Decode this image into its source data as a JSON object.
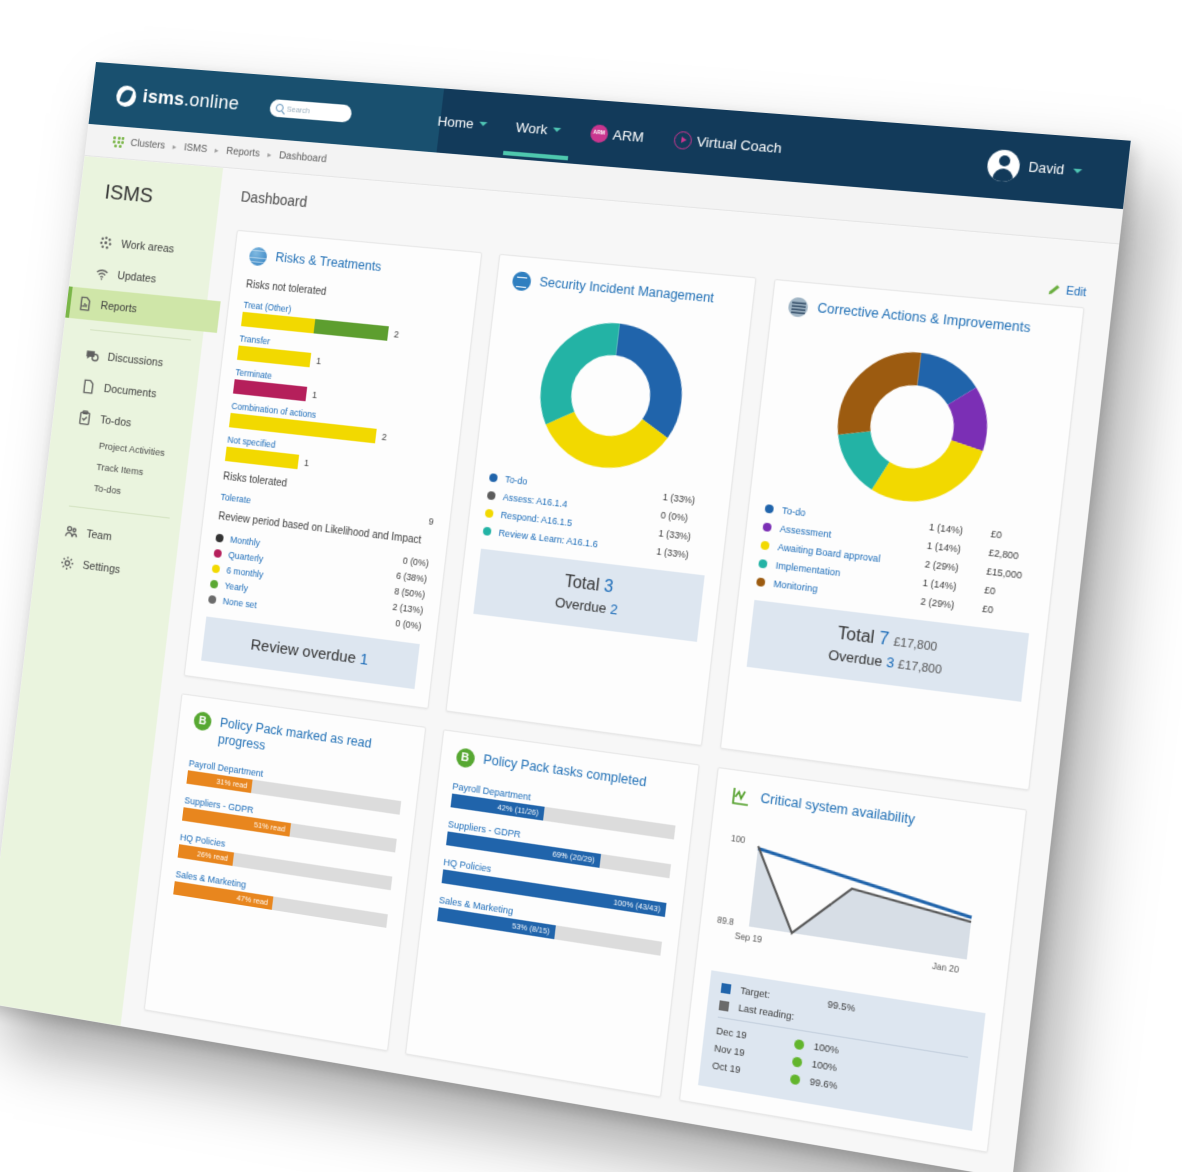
{
  "topnav": {
    "brand_bold": "isms",
    "brand_rest": ".online",
    "search_placeholder": "Search",
    "items": [
      {
        "label": "Home",
        "icon": "chevron-down-icon",
        "active": false
      },
      {
        "label": "Work",
        "icon": "chevron-down-icon",
        "active": true
      },
      {
        "label": "ARM",
        "icon": "arm-badge-icon",
        "active": false
      },
      {
        "label": "Virtual Coach",
        "icon": "play-circle-icon",
        "active": false
      }
    ],
    "arm_badge_text": "ARM",
    "user_name": "David"
  },
  "breadcrumb": {
    "icon": "clusters-grid-icon",
    "items": [
      "Clusters",
      "ISMS",
      "Reports",
      "Dashboard"
    ],
    "separator": "▸"
  },
  "sidebar": {
    "title": "ISMS",
    "group1": [
      {
        "label": "Work areas",
        "icon": "work-areas-icon",
        "active": false
      },
      {
        "label": "Updates",
        "icon": "updates-wifi-icon",
        "active": false
      },
      {
        "label": "Reports",
        "icon": "reports-document-icon",
        "active": true
      }
    ],
    "group2": [
      {
        "label": "Discussions",
        "icon": "discussions-icon",
        "active": false
      },
      {
        "label": "Documents",
        "icon": "documents-icon",
        "active": false
      },
      {
        "label": "To-dos",
        "icon": "todos-clipboard-icon",
        "active": false
      }
    ],
    "subitems": [
      "Project Activities",
      "Track Items",
      "To-dos"
    ],
    "group3": [
      {
        "label": "Team",
        "icon": "team-icon",
        "active": false
      },
      {
        "label": "Settings",
        "icon": "settings-gear-icon",
        "active": false
      }
    ]
  },
  "page": {
    "title": "Dashboard",
    "edit_label": "Edit",
    "edit_icon": "pencil-icon"
  },
  "colors": {
    "brand_navy": "#123a5a",
    "accent_teal": "#4ec8ae",
    "link_blue": "#1a6bb8",
    "green": "#7ab648",
    "yellow": "#f2d900",
    "magenta": "#b51f5b",
    "orange": "#e8861e",
    "blue": "#2064ab",
    "purple": "#7b2fb5",
    "teal": "#23b3a5",
    "brown": "#9c5b10"
  },
  "cards": {
    "risks": {
      "title": "Risks & Treatments",
      "icon": "globe-icon",
      "section_not_tolerated": "Risks not tolerated",
      "chart_data": {
        "type": "bar",
        "title": "Risks not tolerated",
        "categories": [
          "Treat (Other)",
          "Transfer",
          "Terminate",
          "Combination of actions",
          "Not specified"
        ],
        "values": [
          2,
          1,
          1,
          2,
          1
        ],
        "value_labels": [
          "2",
          "1",
          "1",
          "2",
          "1"
        ],
        "segment_colors": [
          [
            "#f2d900",
            "#5d9e2f"
          ],
          [
            "#f2d900"
          ],
          [
            "#b51f5b"
          ],
          [
            "#f2d900"
          ],
          [
            "#f2d900"
          ]
        ],
        "xlabel": "",
        "ylabel": "",
        "xlim": [
          0,
          2
        ]
      },
      "section_tolerated": "Risks tolerated",
      "tolerate_label": "Tolerate",
      "tolerate_value": "9",
      "review_heading": "Review period based on Likelihood and Impact",
      "review_chart": {
        "type": "table",
        "categories": [
          "Monthly",
          "Quarterly",
          "6 monthly",
          "Yearly",
          "None set"
        ],
        "values": [
          0,
          6,
          8,
          2,
          0
        ],
        "percents": [
          "0 (0%)",
          "6 (38%)",
          "8 (50%)",
          "2 (13%)",
          "0 (0%)"
        ],
        "colors": [
          "#333333",
          "#b51f5b",
          "#f2d900",
          "#5aa832",
          "#6b6b6b"
        ]
      },
      "overdue_label": "Review overdue",
      "overdue_value": "1"
    },
    "incidents": {
      "title": "Security Incident Management",
      "icon": "incident-icon",
      "chart_data": {
        "type": "pie",
        "title": "Security Incident Management",
        "labels": [
          "To-do",
          "Assess: A16.1.4",
          "Respond: A16.1.5",
          "Review & Learn: A16.1.6"
        ],
        "values": [
          1,
          0,
          1,
          1
        ],
        "percents": [
          33,
          0,
          33,
          33
        ],
        "display": [
          "1 (33%)",
          "0 (0%)",
          "1 (33%)",
          "1 (33%)"
        ],
        "colors": [
          "#2064ab",
          "#5c5c5c",
          "#f2d900",
          "#23b3a5"
        ],
        "legend_position": "bottom"
      },
      "total_label": "Total",
      "total_value": "3",
      "overdue_label": "Overdue",
      "overdue_value": "2"
    },
    "corrective": {
      "title": "Corrective Actions & Improvements",
      "icon": "corrective-icon",
      "chart_data": {
        "type": "pie",
        "title": "Corrective Actions & Improvements",
        "labels": [
          "To-do",
          "Assessment",
          "Awaiting Board approval",
          "Implementation",
          "Monitoring"
        ],
        "values": [
          1,
          1,
          2,
          1,
          2
        ],
        "percents": [
          14,
          14,
          29,
          14,
          29
        ],
        "display": [
          "1 (14%)",
          "1 (14%)",
          "2 (29%)",
          "1 (14%)",
          "2 (29%)"
        ],
        "amounts": [
          "£0",
          "£2,800",
          "£15,000",
          "£0",
          "£0"
        ],
        "colors": [
          "#2064ab",
          "#7b2fb5",
          "#f2d900",
          "#23b3a5",
          "#9c5b10"
        ],
        "legend_position": "bottom"
      },
      "total_label": "Total",
      "total_value": "7",
      "total_amount": "£17,800",
      "overdue_label": "Overdue",
      "overdue_value": "3",
      "overdue_amount": "£17,800"
    },
    "policy_read": {
      "title": "Policy Pack marked as read progress",
      "icon": "policy-pack-icon",
      "chart_data": {
        "type": "bar",
        "title": "Policy Pack marked as read progress",
        "categories": [
          "Payroll Department",
          "Suppliers - GDPR",
          "HQ Policies",
          "Sales & Marketing"
        ],
        "values": [
          31,
          51,
          26,
          47
        ],
        "labels": [
          "31% read",
          "51% read",
          "26% read",
          "47% read"
        ],
        "color": "#e8861e",
        "track_color": "#dcdcdc",
        "ylim": [
          0,
          100
        ]
      }
    },
    "policy_tasks": {
      "title": "Policy Pack tasks completed",
      "icon": "policy-pack-icon",
      "chart_data": {
        "type": "bar",
        "title": "Policy Pack tasks completed",
        "categories": [
          "Payroll Department",
          "Suppliers - GDPR",
          "HQ Policies",
          "Sales & Marketing"
        ],
        "values": [
          42,
          69,
          100,
          53
        ],
        "labels": [
          "42% (11/26)",
          "69% (20/29)",
          "100% (43/43)",
          "53% (8/15)"
        ],
        "color": "#2064ab",
        "track_color": "#dcdcdc",
        "ylim": [
          0,
          100
        ]
      }
    },
    "availability": {
      "title": "Critical system availability",
      "icon": "line-chart-icon",
      "chart_data": {
        "type": "line",
        "title": "Critical system availability",
        "x": [
          "Sep 19",
          "Oct 19",
          "Nov 19",
          "Dec 19",
          "Jan 20"
        ],
        "xtick_labels": [
          "Sep 19",
          "Jan 20"
        ],
        "ytick_labels": [
          "100",
          "89.8"
        ],
        "ylim": [
          89.8,
          100
        ],
        "series": [
          {
            "name": "Target",
            "values": [
              99.5,
              99.5,
              99.5,
              99.5,
              99.5
            ],
            "color": "#2064ab"
          },
          {
            "name": "Last reading",
            "values": [
              100,
              89.8,
              99.6,
              100,
              100
            ],
            "color": "#5c5c5c"
          }
        ],
        "legend_position": "bottom"
      },
      "target_label": "Target:",
      "target_value": "99.5%",
      "last_reading_label": "Last reading:",
      "readings": [
        {
          "month": "Dec 19",
          "value": "100%"
        },
        {
          "month": "Nov 19",
          "value": "100%"
        },
        {
          "month": "Oct 19",
          "value": "99.6%"
        }
      ]
    }
  }
}
